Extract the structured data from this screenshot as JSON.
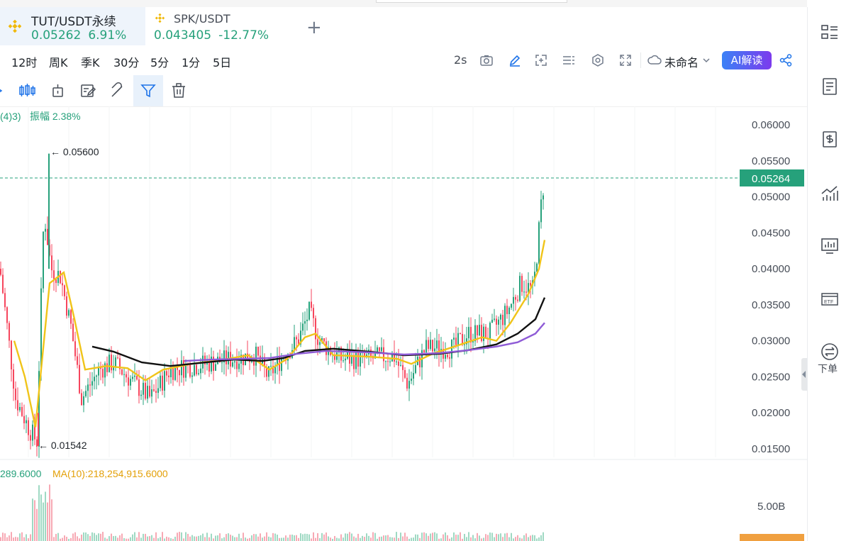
{
  "tabs": [
    {
      "symbol": "TUT/USDT永续",
      "price": "0.05262",
      "change": "6.91%"
    },
    {
      "symbol": "SPK/USDT",
      "price": "0.043405",
      "change": "-12.77%"
    }
  ],
  "add_tab": "+",
  "intervals": [
    "12时",
    "周K",
    "季K",
    "30分",
    "5分",
    "1分",
    "5日"
  ],
  "refresh": "2s",
  "layout_name": "未命名",
  "ai_label": "AI解读",
  "indicator": {
    "prefix": "(4)3)",
    "amplitude": "振幅 2.38%"
  },
  "price_axis": [
    "0.06000",
    "0.05500",
    "0.05000",
    "0.04500",
    "0.04000",
    "0.03500",
    "0.03000",
    "0.02500",
    "0.02000",
    "0.01500"
  ],
  "current_price": "0.05264",
  "high_label": "← 0.05600",
  "low_label": "← 0.01542",
  "volume": {
    "vol": "289.6000",
    "ma10": "MA(10):218,254,915.6000",
    "axis": "5.00B"
  },
  "sidebar": {
    "swap_label": "下单"
  },
  "colors": {
    "up": "#26a17b",
    "down": "#f6465d",
    "ma_short": "#f0c419",
    "ma_mid": "#111111",
    "ma_long": "#8e5bd6"
  }
}
